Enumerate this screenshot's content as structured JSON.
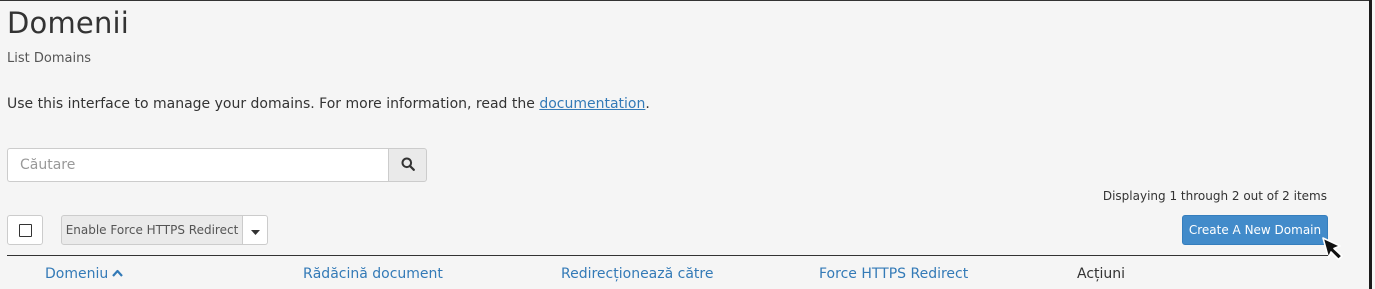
{
  "page": {
    "title": "Domenii",
    "subtitle": "List Domains",
    "description_prefix": "Use this interface to manage your domains. For more information, read the ",
    "description_link": "documentation",
    "description_suffix": "."
  },
  "search": {
    "placeholder": "Căutare",
    "value": "",
    "button_icon": "search-icon"
  },
  "pagination": {
    "summary": "Displaying 1 through 2 out of 2 items"
  },
  "toolbar": {
    "select_all_checked": false,
    "bulk_action_label": "Enable Force HTTPS Redirect",
    "bulk_caret_icon": "caret-down-icon",
    "create_label": "Create A New Domain"
  },
  "table": {
    "columns": [
      {
        "label": "Domeniu",
        "sortable": true,
        "sorted": "asc"
      },
      {
        "label": "Rădăcină document",
        "sortable": true
      },
      {
        "label": "Redirecționează către",
        "sortable": true
      },
      {
        "label": "Force HTTPS Redirect",
        "sortable": true
      },
      {
        "label": "Acțiuni",
        "sortable": false
      }
    ]
  },
  "colors": {
    "background": "#f5f5f5",
    "link": "#337ab7",
    "primary_button": "#428bca",
    "text": "#333333"
  }
}
